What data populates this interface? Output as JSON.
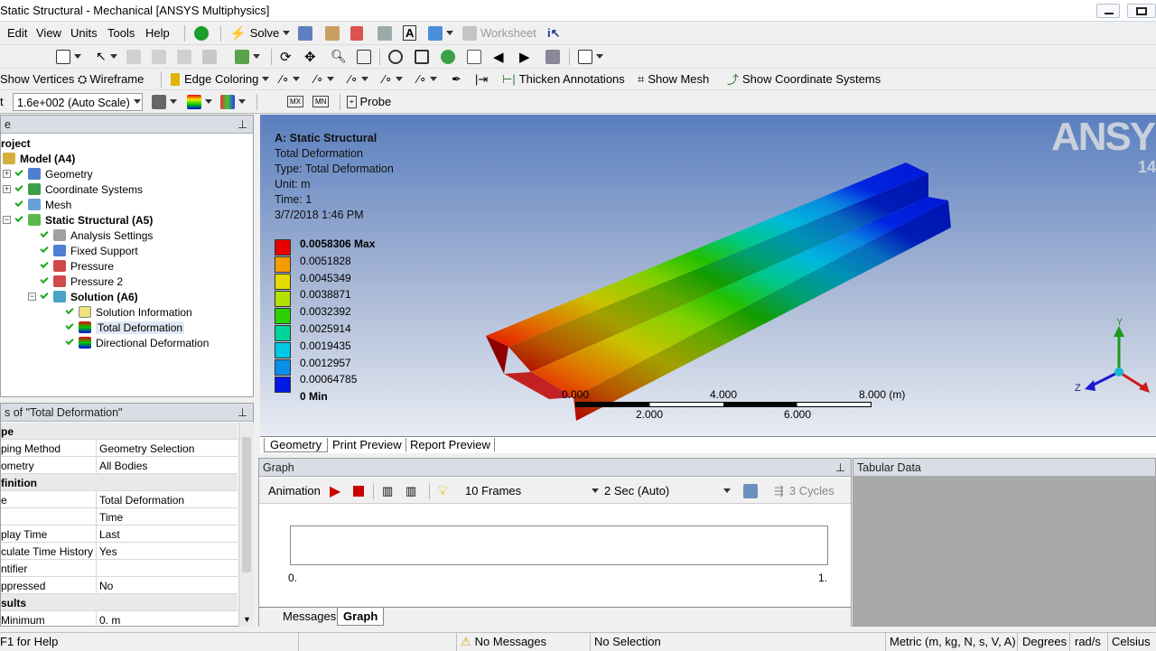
{
  "window": {
    "title": "Static Structural - Mechanical [ANSYS Multiphysics]"
  },
  "menu": {
    "items": [
      "Edit",
      "View",
      "Units",
      "Tools",
      "Help"
    ],
    "solve_label": "Solve",
    "worksheet_label": "Worksheet"
  },
  "toolbar3": {
    "show_vertices": "Show Vertices",
    "wireframe": "Wireframe",
    "edge_coloring": "Edge Coloring",
    "thicken_annotations": "Thicken Annotations",
    "show_mesh": "Show Mesh",
    "show_coordinate_systems": "Show Coordinate Systems"
  },
  "toolbar4": {
    "scale_prefix": "t",
    "scale_value": "1.6e+002 (Auto Scale)",
    "probe_label": "Probe"
  },
  "outline": {
    "header": "e",
    "root": "roject",
    "nodes": [
      {
        "label": "Model (A4)",
        "bold": true
      },
      {
        "label": "Geometry"
      },
      {
        "label": "Coordinate Systems"
      },
      {
        "label": "Mesh"
      },
      {
        "label": "Static Structural (A5)",
        "bold": true
      },
      {
        "label": "Analysis Settings"
      },
      {
        "label": "Fixed Support"
      },
      {
        "label": "Pressure"
      },
      {
        "label": "Pressure 2"
      },
      {
        "label": "Solution (A6)",
        "bold": true
      },
      {
        "label": "Solution Information"
      },
      {
        "label": "Total Deformation"
      },
      {
        "label": "Directional Deformation"
      }
    ]
  },
  "details": {
    "header": "s of \"Total Deformation\"",
    "rows": [
      {
        "key": "pe",
        "value": "",
        "group": true
      },
      {
        "key": "ping Method",
        "value": "Geometry Selection"
      },
      {
        "key": "ometry",
        "value": "All Bodies"
      },
      {
        "key": "finition",
        "value": "",
        "group": true
      },
      {
        "key": "e",
        "value": "Total Deformation"
      },
      {
        "key": "",
        "value": "Time"
      },
      {
        "key": "play Time",
        "value": "Last"
      },
      {
        "key": "culate Time History",
        "value": "Yes"
      },
      {
        "key": "ntifier",
        "value": ""
      },
      {
        "key": "ppressed",
        "value": "No"
      },
      {
        "key": "sults",
        "value": "",
        "group": true
      },
      {
        "key": "Minimum",
        "value": "0. m"
      }
    ]
  },
  "result_info": {
    "lines": [
      "A: Static Structural",
      "Total Deformation",
      "Type: Total Deformation",
      "Unit: m",
      "Time: 1",
      "3/7/2018 1:46 PM"
    ]
  },
  "legend": {
    "labels": [
      "0.0058306 Max",
      "0.0051828",
      "0.0045349",
      "0.0038871",
      "0.0032392",
      "0.0025914",
      "0.0019435",
      "0.0012957",
      "0.00064785",
      "0 Min"
    ],
    "colors": [
      "#e80000",
      "#f59d00",
      "#e5d900",
      "#b4e000",
      "#2bd100",
      "#00d69a",
      "#00c8e6",
      "#0a8fe8",
      "#0018e8"
    ]
  },
  "scale_bar": {
    "top_labels": [
      "0.000",
      "4.000",
      "8.000 (m)"
    ],
    "bottom_labels": [
      "2.000",
      "6.000"
    ]
  },
  "triad": {
    "y": "Y",
    "z": "Z"
  },
  "brand": {
    "logo_text": "ANSY",
    "version": "14"
  },
  "view_tabs": [
    "Geometry",
    "Print Preview",
    "Report Preview"
  ],
  "graph_panel": {
    "header": "Graph",
    "animation_label": "Animation",
    "frames": "10 Frames",
    "duration": "2 Sec (Auto)",
    "cycles": "3 Cycles",
    "x_start": "0.",
    "x_end": "1.",
    "bottom_tabs": [
      "Messages",
      "Graph"
    ]
  },
  "tabular": {
    "header": "Tabular Data"
  },
  "status": {
    "help": "F1 for Help",
    "messages": "No Messages",
    "selection": "No Selection",
    "units": "Metric (m, kg, N, s, V, A)",
    "angle": "Degrees",
    "rate": "rad/s",
    "temp": "Celsius"
  }
}
